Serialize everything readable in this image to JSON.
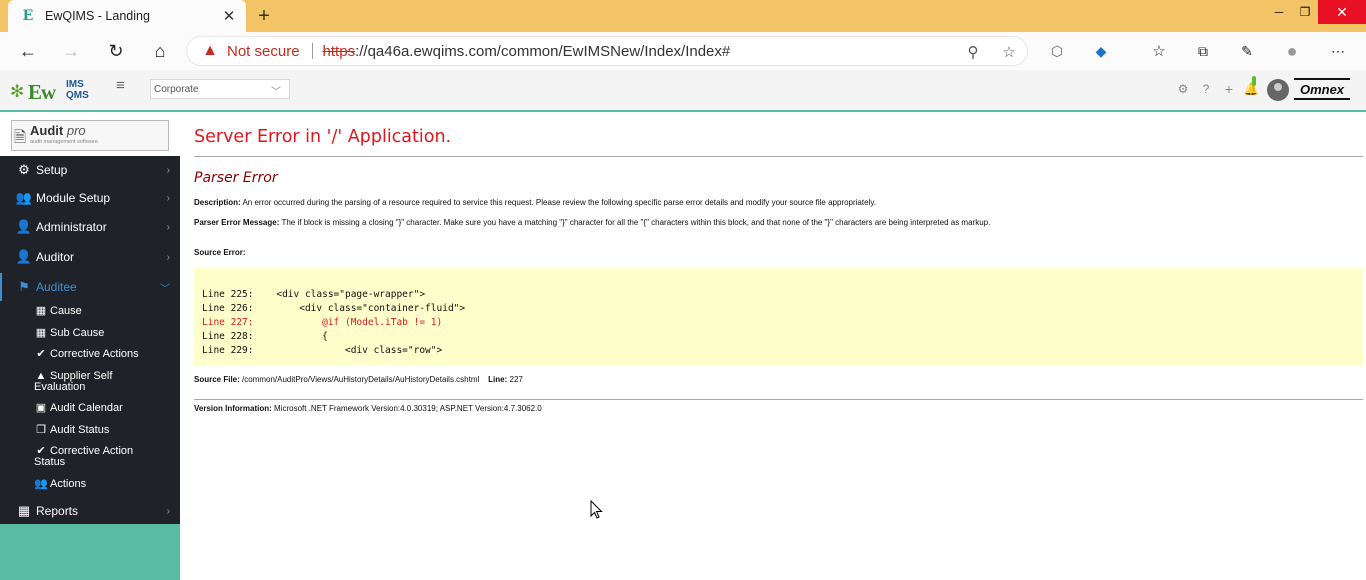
{
  "browser": {
    "tab_title": "EwQIMS - Landing",
    "tab_favicon": "E",
    "new_tab": "+",
    "not_secure": "Not secure",
    "url_scheme": "https",
    "url_rest": "://qa46a.ewqims.com/common/EwIMSNew/Index/Index#"
  },
  "header": {
    "logo_ew": "Ew",
    "logo_ims": "IMS",
    "logo_qms": "QMS",
    "company_select": "Corporate",
    "brand": "Omnex"
  },
  "sidebar": {
    "module_title": "Audit",
    "module_title_suffix": "pro",
    "module_subtitle": "audit management software",
    "items": [
      {
        "label": "Setup",
        "icon": "gear-icon"
      },
      {
        "label": "Module Setup",
        "icon": "users-gear-icon"
      },
      {
        "label": "Administrator",
        "icon": "user-gear-icon"
      },
      {
        "label": "Auditor",
        "icon": "user-check-icon"
      },
      {
        "label": "Auditee",
        "icon": "presentation-icon"
      }
    ],
    "subitems": [
      {
        "label": "Cause",
        "icon": "building-icon"
      },
      {
        "label": "Sub Cause",
        "icon": "building-icon"
      },
      {
        "label": "Corrective Actions",
        "icon": "check-double-icon"
      },
      {
        "label": "Supplier Self Evaluation",
        "icon": "warning-icon"
      },
      {
        "label": "Audit Calendar",
        "icon": "calendar-check-icon"
      },
      {
        "label": "Audit Status",
        "icon": "copy-icon"
      },
      {
        "label": "Corrective Action Status",
        "icon": "check-icon"
      },
      {
        "label": "Actions",
        "icon": "users-icon"
      }
    ],
    "reports": {
      "label": "Reports",
      "icon": "building-icon"
    }
  },
  "error": {
    "title": "Server Error in '/' Application.",
    "subtitle": "Parser Error",
    "description_label": "Description:",
    "description": " An error occurred during the parsing of a resource required to service this request. Please review the following specific parse error details and modify your source file appropriately.",
    "message_label": "Parser Error Message:",
    "message": " The if block is missing a closing \"}\" character.  Make sure you have a matching \"}\" character for all the \"{\" characters within this block, and that none of the \"}\" characters are being interpreted as markup.",
    "source_error_label": "Source Error:",
    "code_lines": [
      "Line 225:    <div class=\"page-wrapper\">",
      "Line 226:        <div class=\"container-fluid\">",
      "Line 227:            @if (Model.iTab != 1)",
      "Line 228:            {",
      "Line 229:                <div class=\"row\">"
    ],
    "highlight_line": "Line 227:            @if (Model.iTab != 1)",
    "source_file_label": "Source File:",
    "source_file": " /common/AuditPro/Views/AuHistoryDetails/AuHistoryDetails.cshtml",
    "line_label": "Line:",
    "line_number": " 227",
    "version_label": "Version Information:",
    "version": " Microsoft .NET Framework Version:4.0.30319; ASP.NET Version:4.7.3062.0"
  }
}
